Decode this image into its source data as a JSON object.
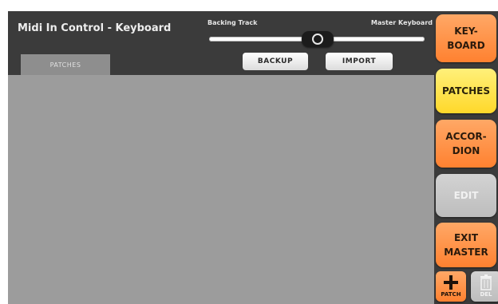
{
  "window": {
    "title": "Midi In Control - Keyboard"
  },
  "tabs": [
    {
      "label": "PATCHES"
    }
  ],
  "slider": {
    "left_label": "Backing Track",
    "right_label": "Master Keyboard"
  },
  "toolbar": {
    "backup_label": "BACKUP",
    "import_label": "IMPORT"
  },
  "sidebar": {
    "keyboard_label": "KEY-\nBOARD",
    "patches_label": "PATCHES",
    "accordion_label": "ACCOR-\nDION",
    "edit_label": "EDIT",
    "exit_master_label": "EXIT\nMASTER",
    "add_patch_label": "PATCH",
    "del_label": "DEL"
  },
  "icons": {
    "add": "plus-icon",
    "delete": "trash-icon"
  },
  "colors": {
    "orange_button": "#ff8f3f",
    "yellow_button": "#ffe04a",
    "gray_button": "#c9c9c9",
    "background": "#3b3b3b",
    "content_area": "#9c9c9c"
  }
}
